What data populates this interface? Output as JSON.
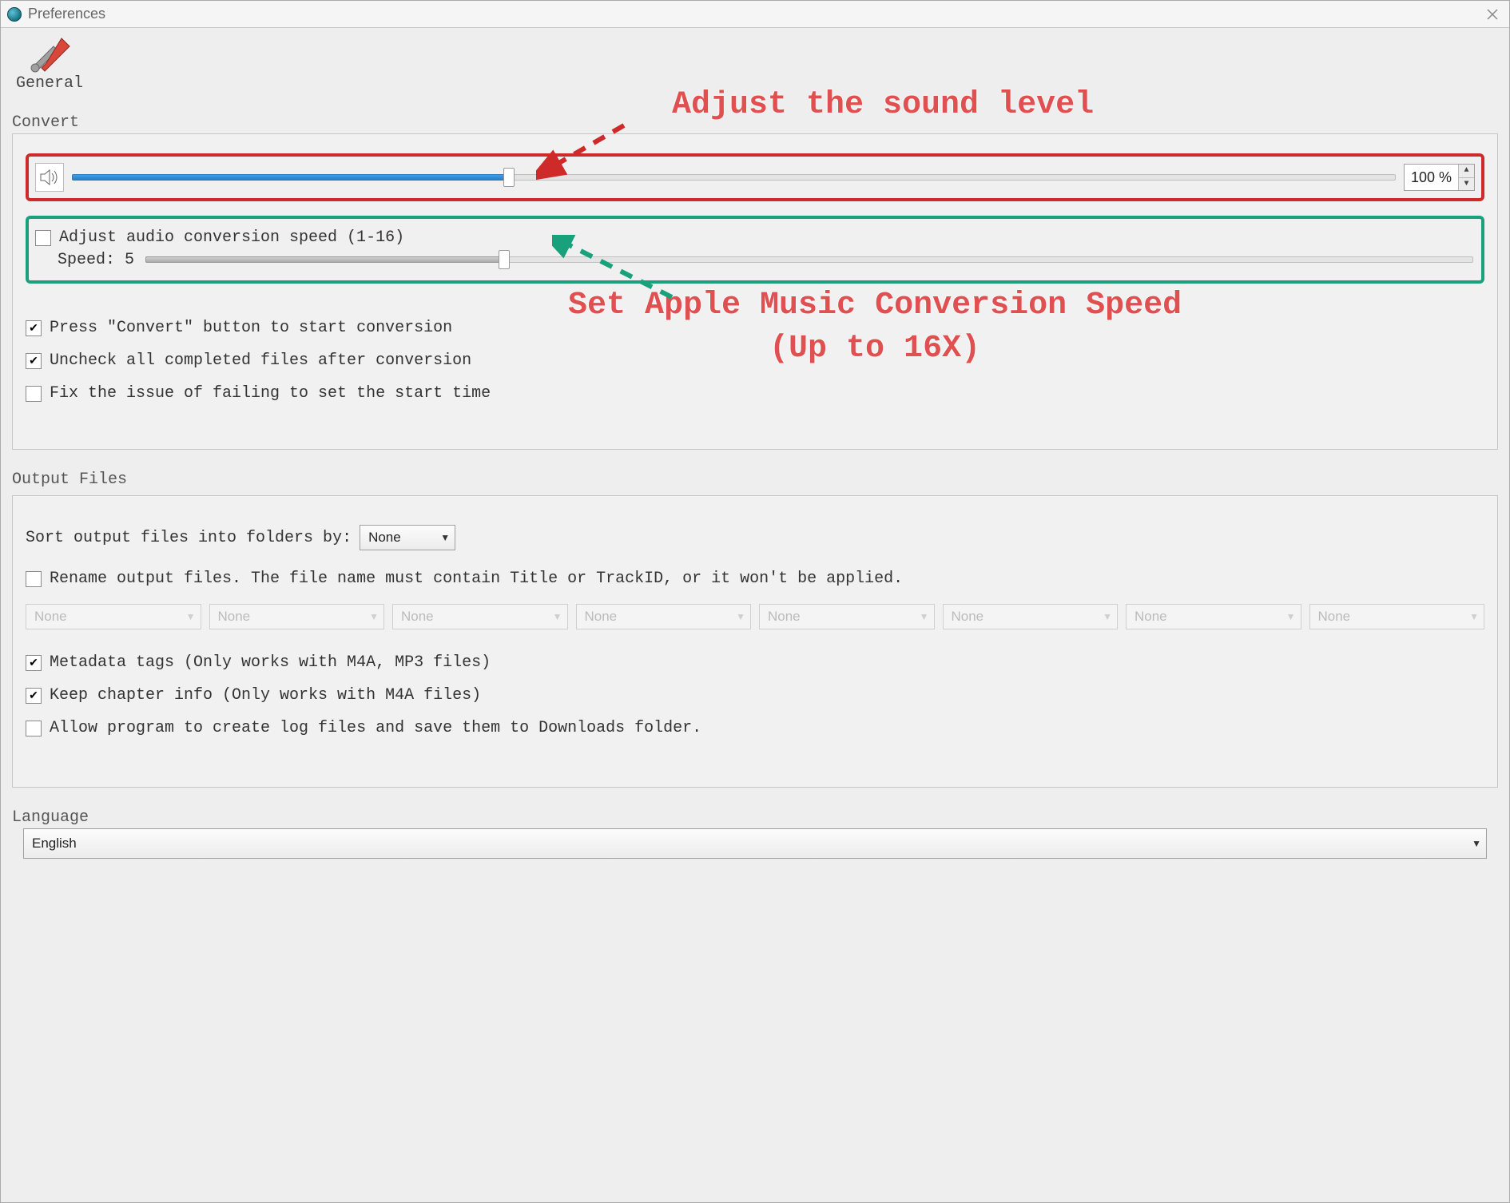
{
  "window": {
    "title": "Preferences"
  },
  "tabs": {
    "general": "General"
  },
  "sections": {
    "convert": "Convert",
    "output_files": "Output Files",
    "language": "Language"
  },
  "convert": {
    "volume_percent_fill": 33,
    "volume_value": "100 %",
    "adjust_speed_label": "Adjust audio conversion speed (1-16)",
    "adjust_speed_checked": false,
    "speed_label": "Speed: 5",
    "speed_percent_fill": 27,
    "checks": {
      "press_convert": {
        "label": "Press \"Convert\" button to start conversion",
        "checked": true
      },
      "uncheck_completed": {
        "label": "Uncheck all completed files after conversion",
        "checked": true
      },
      "fix_start_time": {
        "label": "Fix the issue of failing to set the start time",
        "checked": false
      }
    }
  },
  "output": {
    "sort_label": "Sort output files into folders by:",
    "sort_value": "None",
    "rename": {
      "checked": false,
      "label": "Rename output files. The file name must contain Title or TrackID, or it won't be applied."
    },
    "rename_fields": [
      "None",
      "None",
      "None",
      "None",
      "None",
      "None",
      "None",
      "None"
    ],
    "checks": {
      "metadata": {
        "label": "Metadata tags (Only works with M4A, MP3 files)",
        "checked": true
      },
      "chapter": {
        "label": "Keep chapter info (Only works with M4A files)",
        "checked": true
      },
      "logs": {
        "label": "Allow program to create log files and save them to Downloads folder.",
        "checked": false
      }
    }
  },
  "language": {
    "value": "English"
  },
  "annotations": {
    "sound": "Adjust the sound level",
    "speed_line1": "Set Apple Music Conversion Speed",
    "speed_line2": "(Up to 16X)"
  }
}
